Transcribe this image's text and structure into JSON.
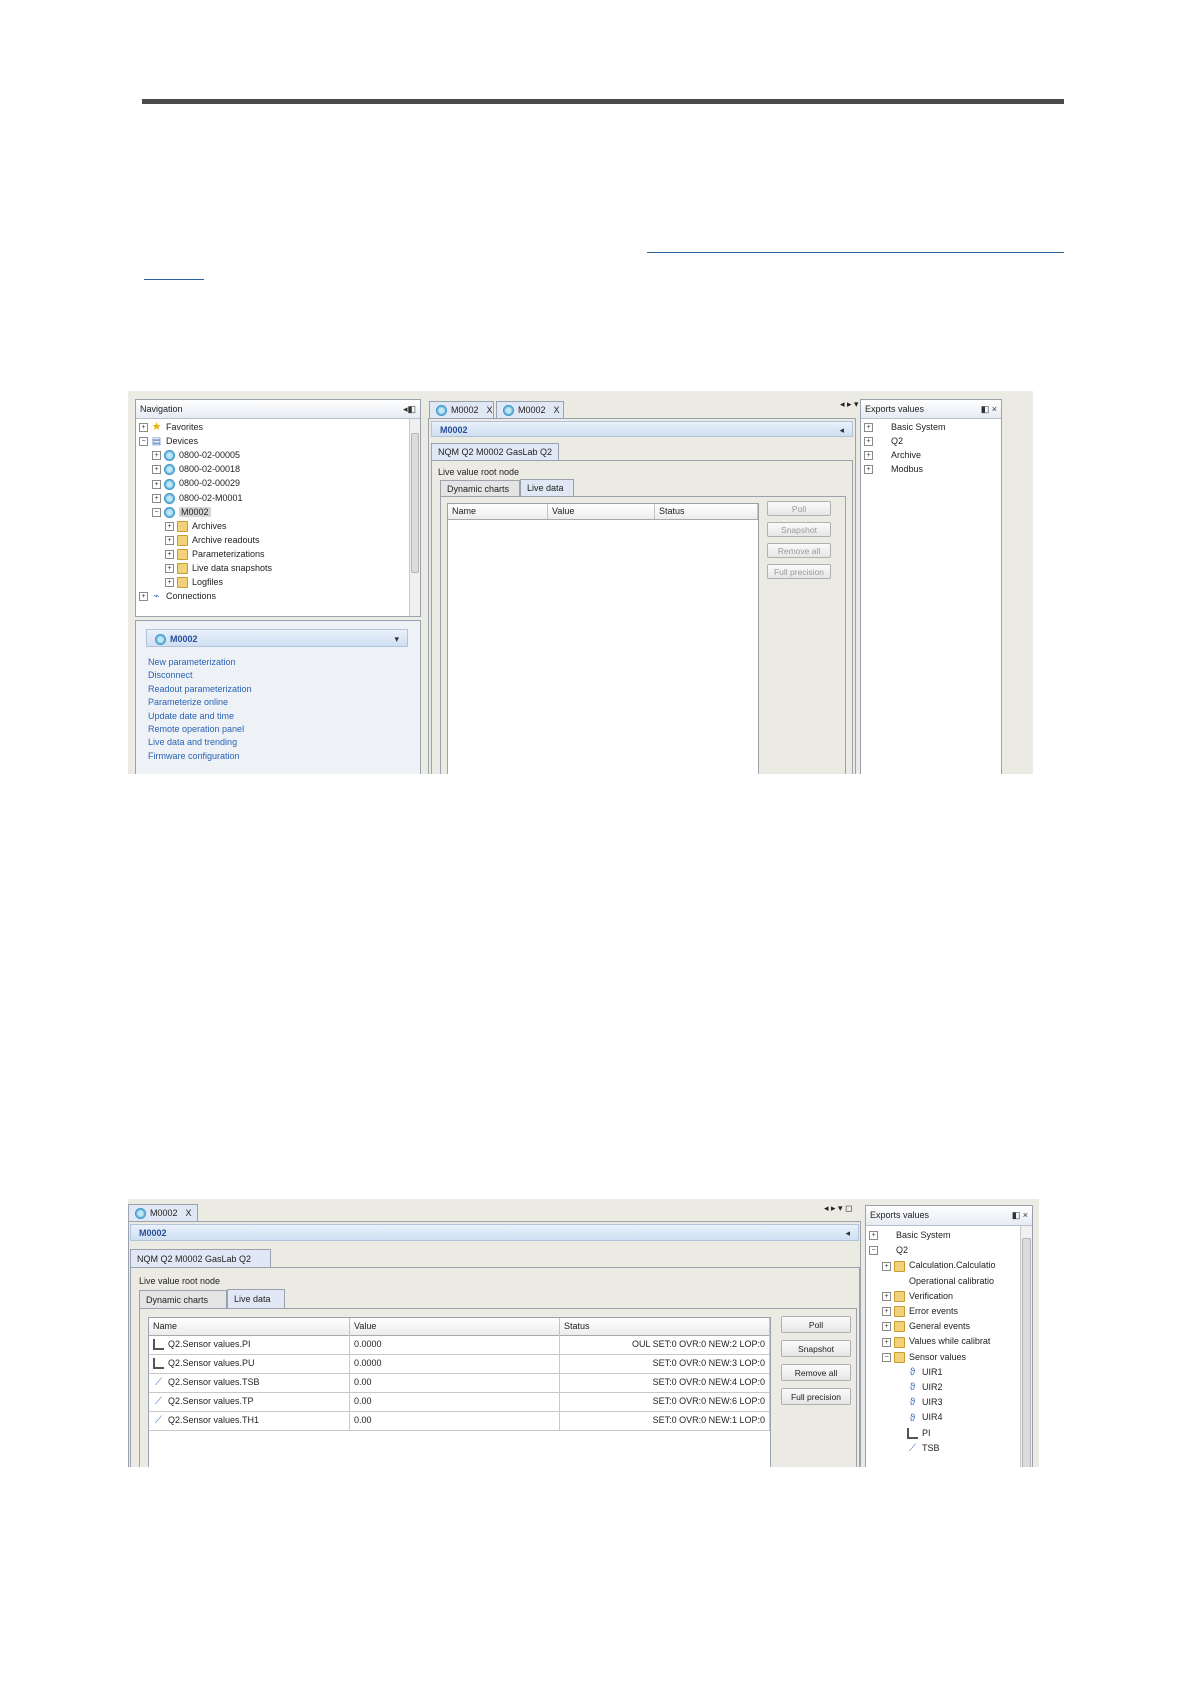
{
  "shot1": {
    "navigation": {
      "title": "Navigation",
      "pin": "◂◧",
      "tree": [
        {
          "label": "Favorites",
          "icon": "star-icon",
          "level": 0,
          "expander": "+"
        },
        {
          "label": "Devices",
          "icon": "devices-icon",
          "level": 0,
          "expander": "−"
        },
        {
          "label": "0800-02-00005",
          "icon": "device-icon",
          "level": 1,
          "expander": "+"
        },
        {
          "label": "0800-02-00018",
          "icon": "device-icon",
          "level": 1,
          "expander": "+"
        },
        {
          "label": "0800-02-00029",
          "icon": "device-icon",
          "level": 1,
          "expander": "+"
        },
        {
          "label": "0800-02-M0001",
          "icon": "device-icon",
          "level": 1,
          "expander": "+"
        },
        {
          "label": "M0002",
          "icon": "device-icon",
          "level": 1,
          "expander": "−",
          "selected": true
        },
        {
          "label": "Archives",
          "icon": "folder-icon",
          "level": 2,
          "expander": "+"
        },
        {
          "label": "Archive readouts",
          "icon": "folder-icon",
          "level": 2,
          "expander": "+"
        },
        {
          "label": "Parameterizations",
          "icon": "folder-icon",
          "level": 2,
          "expander": "+"
        },
        {
          "label": "Live data snapshots",
          "icon": "folder-icon",
          "level": 2,
          "expander": "+"
        },
        {
          "label": "Logfiles",
          "icon": "folder-icon",
          "level": 2,
          "expander": "+"
        },
        {
          "label": "Connections",
          "icon": "connections-icon",
          "level": 0,
          "expander": "+"
        }
      ],
      "task_title": "M0002",
      "tasks": [
        "New parameterization",
        "Disconnect",
        "Readout parameterization",
        "Parameterize online",
        "Update date and time",
        "Remote operation panel",
        "Live data and trending",
        "Firmware configuration"
      ]
    },
    "tabs": [
      {
        "label": "M0002",
        "close": "X"
      },
      {
        "label": "M0002",
        "close": "X"
      }
    ],
    "view_controls": "◂ ▸ ▾ ◻",
    "bluebar": "M0002",
    "bluebar_arrow": "◂",
    "subtab": "NQM Q2 M0002 GasLab Q2",
    "root_label": "Live value root node",
    "inner_tabs": [
      "Dynamic charts",
      "Live data"
    ],
    "columns": [
      "Name",
      "Value",
      "Status"
    ],
    "buttons": [
      "Poll",
      "Snapshot",
      "Remove all",
      "Full precision"
    ],
    "exports": {
      "title": "Exports values",
      "controls": "◧ ×",
      "tree": [
        {
          "label": "Basic System",
          "expander": "+"
        },
        {
          "label": "Q2",
          "expander": "+"
        },
        {
          "label": "Archive",
          "expander": "+"
        },
        {
          "label": "Modbus",
          "expander": "+"
        }
      ]
    }
  },
  "shot2": {
    "tab": {
      "label": "M0002",
      "close": "X"
    },
    "view_controls": "◂ ▸ ▾ ◻",
    "bluebar": "M0002",
    "bluebar_arrow": "◂",
    "subtab": "NQM Q2 M0002 GasLab Q2",
    "root_label": "Live value root node",
    "inner_tabs": [
      "Dynamic charts",
      "Live data"
    ],
    "columns": [
      "Name",
      "Value",
      "Status"
    ],
    "rows": [
      {
        "name": "Q2.Sensor values.PI",
        "value": "0.0000",
        "status": "OUL SET:0 OVR:0 NEW:2 LOP:0",
        "icon": "chart-icon"
      },
      {
        "name": "Q2.Sensor values.PU",
        "value": "0.0000",
        "status": "SET:0 OVR:0 NEW:3 LOP:0",
        "icon": "chart-icon"
      },
      {
        "name": "Q2.Sensor values.TSB",
        "value": "0.00",
        "status": "SET:0 OVR:0 NEW:4 LOP:0",
        "icon": "thermometer-icon"
      },
      {
        "name": "Q2.Sensor values.TP",
        "value": "0.00",
        "status": "SET:0 OVR:0 NEW:6 LOP:0",
        "icon": "thermometer-icon"
      },
      {
        "name": "Q2.Sensor values.TH1",
        "value": "0.00",
        "status": "SET:0 OVR:0 NEW:1 LOP:0",
        "icon": "thermometer-icon"
      }
    ],
    "buttons": [
      "Poll",
      "Snapshot",
      "Remove all",
      "Full precision"
    ],
    "exports": {
      "title": "Exports values",
      "controls": "◧ ×",
      "tree": [
        {
          "label": "Basic System",
          "level": 0,
          "expander": "+"
        },
        {
          "label": "Q2",
          "level": 0,
          "expander": "−"
        },
        {
          "label": "Calculation.Calculatio",
          "level": 1,
          "expander": "+"
        },
        {
          "label": "Operational calibratio",
          "level": 1,
          "expander": ""
        },
        {
          "label": "Verification",
          "level": 1,
          "expander": "+"
        },
        {
          "label": "Error events",
          "level": 1,
          "expander": "+"
        },
        {
          "label": "General events",
          "level": 1,
          "expander": "+"
        },
        {
          "label": "Values while calibrat",
          "level": 1,
          "expander": "+"
        },
        {
          "label": "Sensor values",
          "level": 1,
          "expander": "−"
        },
        {
          "label": "UIR1",
          "level": 2,
          "expander": ""
        },
        {
          "label": "UIR2",
          "level": 2,
          "expander": ""
        },
        {
          "label": "UIR3",
          "level": 2,
          "expander": ""
        },
        {
          "label": "UIR4",
          "level": 2,
          "expander": ""
        },
        {
          "label": "PI",
          "level": 2,
          "expander": ""
        },
        {
          "label": "TSB",
          "level": 2,
          "expander": ""
        }
      ]
    }
  }
}
